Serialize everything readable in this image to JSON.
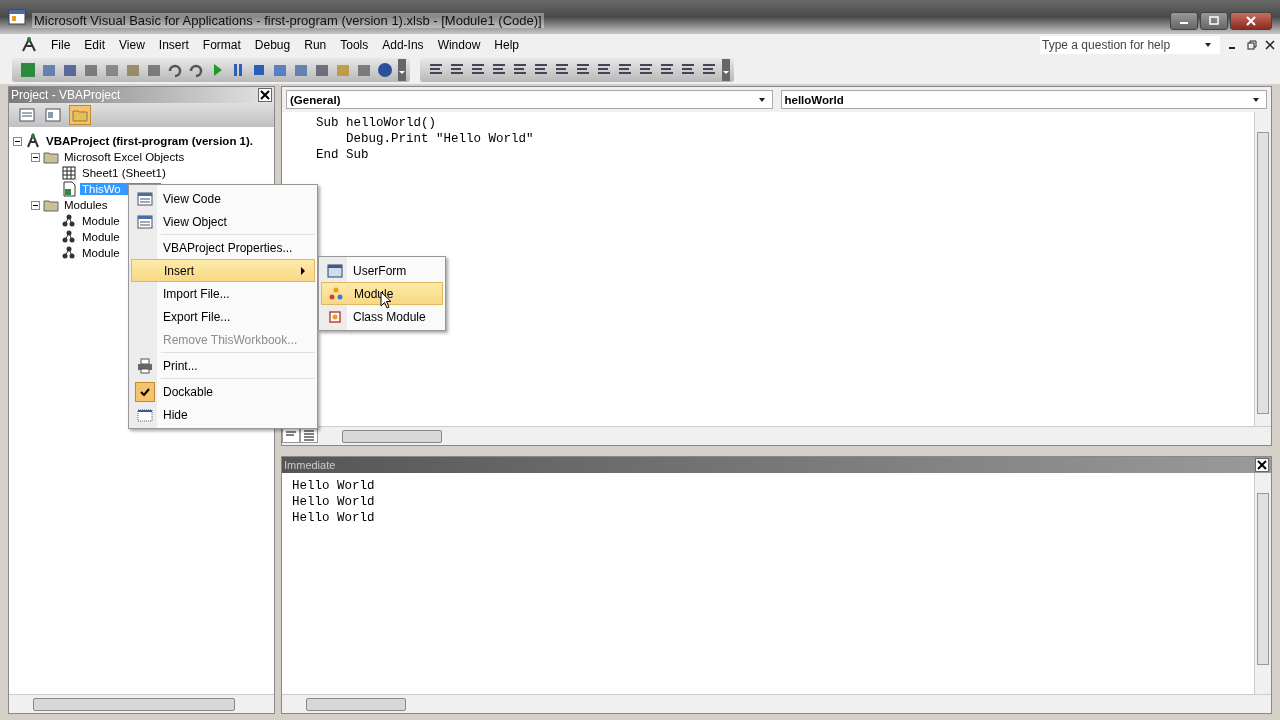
{
  "window": {
    "title": "Microsoft Visual Basic for Applications - first-program (version 1).xlsb - [Module1 (Code)]"
  },
  "menu_bar": [
    "File",
    "Edit",
    "View",
    "Insert",
    "Format",
    "Debug",
    "Run",
    "Tools",
    "Add-Ins",
    "Window",
    "Help"
  ],
  "help_search": {
    "placeholder": "Type a question for help"
  },
  "project": {
    "title": "Project - VBAProject",
    "tree": [
      {
        "label": "VBAProject (first-program (version 1).",
        "kind": "project",
        "expanded": true,
        "selected": false,
        "children": [
          {
            "label": "Microsoft Excel Objects",
            "kind": "folder",
            "expanded": true,
            "selected": false,
            "children": [
              {
                "label": "Sheet1 (Sheet1)",
                "kind": "sheet",
                "selected": false
              },
              {
                "label": "ThisWo",
                "kind": "workbook",
                "selected": true
              }
            ]
          },
          {
            "label": "Modules",
            "kind": "folder",
            "expanded": true,
            "selected": false,
            "children": [
              {
                "label": "Module",
                "kind": "module",
                "selected": false
              },
              {
                "label": "Module",
                "kind": "module",
                "selected": false
              },
              {
                "label": "Module",
                "kind": "module",
                "selected": false
              }
            ]
          }
        ]
      }
    ]
  },
  "code": {
    "object": "(General)",
    "procedure": "helloWorld",
    "lines": [
      "Sub helloWorld()",
      "    Debug.Print \"Hello World\"",
      "End Sub"
    ]
  },
  "immediate": {
    "title": "Immediate",
    "lines": [
      "Hello World",
      "Hello World",
      "Hello World"
    ]
  },
  "context_menu": {
    "groups": [
      [
        {
          "label": "View Code",
          "selected": false,
          "disabled": false,
          "checked": false
        },
        {
          "label": "View Object",
          "selected": false,
          "disabled": false,
          "checked": false
        }
      ],
      [
        {
          "label": "VBAProject Properties...",
          "selected": false,
          "disabled": false,
          "checked": false
        },
        {
          "label": "Insert",
          "selected": true,
          "disabled": false,
          "checked": false,
          "submenu": [
            {
              "label": "UserForm",
              "selected": false
            },
            {
              "label": "Module",
              "selected": true
            },
            {
              "label": "Class Module",
              "selected": false
            }
          ]
        },
        {
          "label": "Import File...",
          "selected": false,
          "disabled": false,
          "checked": false
        },
        {
          "label": "Export File...",
          "selected": false,
          "disabled": false,
          "checked": false
        },
        {
          "label": "Remove ThisWorkbook...",
          "selected": false,
          "disabled": true,
          "checked": false
        }
      ],
      [
        {
          "label": "Print...",
          "selected": false,
          "disabled": false,
          "checked": false
        }
      ],
      [
        {
          "label": "Dockable",
          "selected": false,
          "disabled": false,
          "checked": true
        },
        {
          "label": "Hide",
          "selected": false,
          "disabled": false,
          "checked": false
        }
      ]
    ]
  }
}
